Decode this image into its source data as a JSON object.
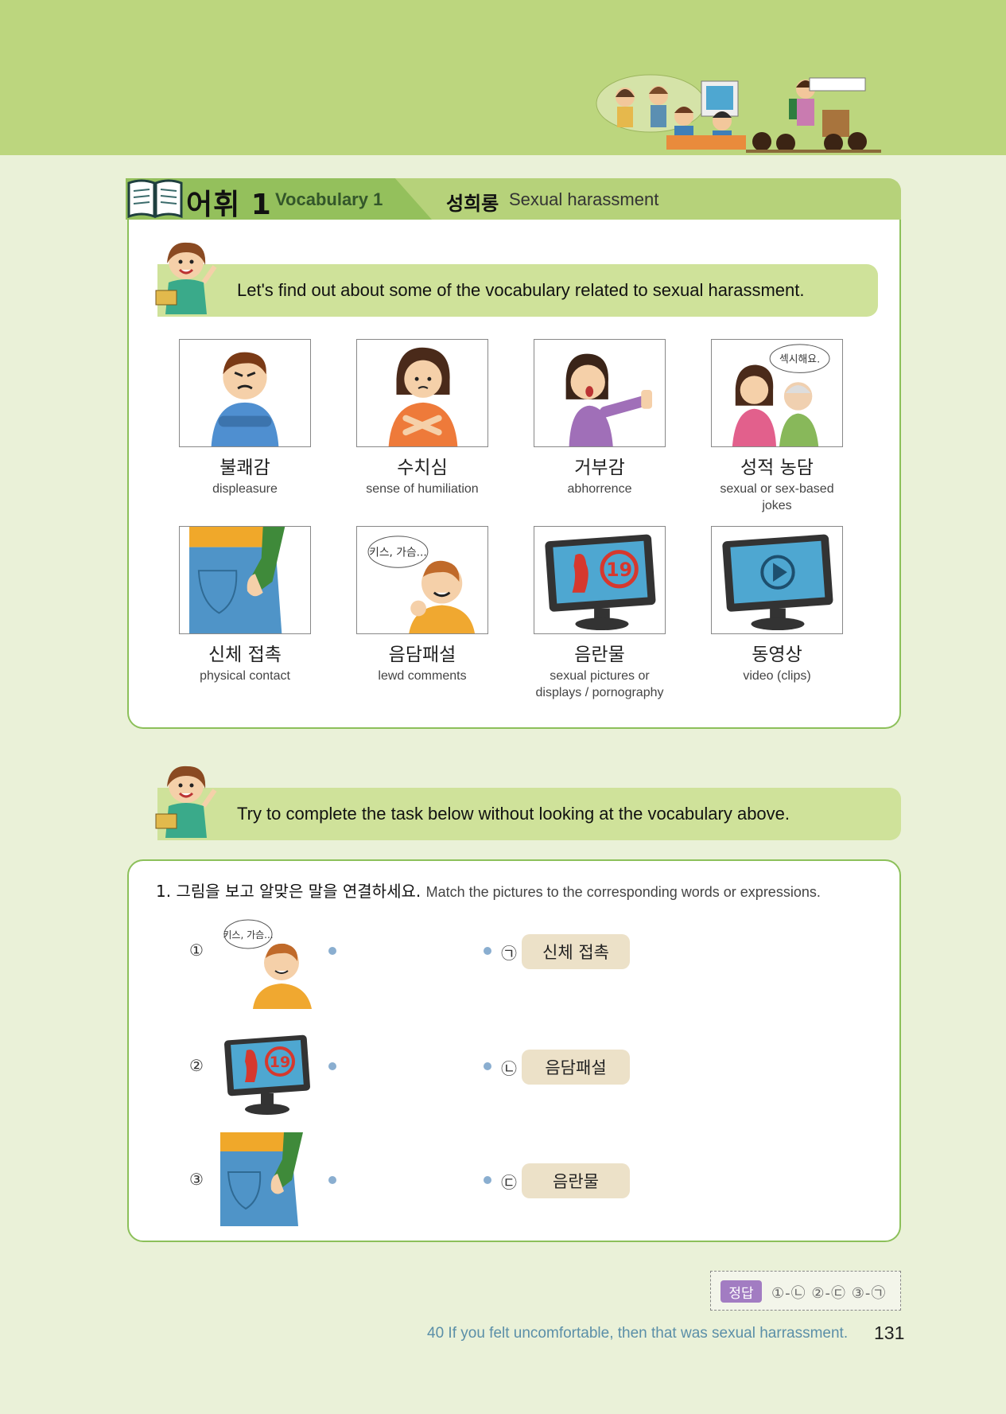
{
  "header": {
    "section_ko": "어휘 1",
    "section_en": "Vocabulary 1",
    "topic_ko": "성희롱",
    "topic_en": "Sexual harassment"
  },
  "intro": {
    "text1": "Let's find out about some of the vocabulary related to sexual harassment.",
    "text2": "Try to complete the task below without looking at the vocabulary above."
  },
  "vocabulary": [
    {
      "ko": "불쾌감",
      "en": "displeasure"
    },
    {
      "ko": "수치심",
      "en": "sense of humiliation"
    },
    {
      "ko": "거부감",
      "en": "abhorrence"
    },
    {
      "ko": "성적 농담",
      "en": "sexual or sex-based jokes"
    },
    {
      "ko": "신체 접촉",
      "en": "physical contact"
    },
    {
      "ko": "음담패설",
      "en": "lewd comments"
    },
    {
      "ko": "음란물",
      "en": "sexual pictures or displays / pornography"
    },
    {
      "ko": "동영상",
      "en": "video (clips)"
    }
  ],
  "picture_text": {
    "speech_joke": "섹시해요.",
    "speech_lewd": "키스, 가슴...",
    "sign_19": "19"
  },
  "exercise": {
    "question_ko": "1. 그림을 보고 알맞은 말을 연결하세요.",
    "question_en": "Match the pictures to the corresponding words or expressions.",
    "left": [
      "①",
      "②",
      "③"
    ],
    "right": [
      {
        "mark": "㉠",
        "word": "신체 접촉"
      },
      {
        "mark": "㉡",
        "word": "음담패설"
      },
      {
        "mark": "㉢",
        "word": "음란물"
      }
    ]
  },
  "answer": {
    "label": "정답",
    "text": "①-㉡  ②-㉢  ③-㉠"
  },
  "footer": {
    "text": "40 If you felt uncomfortable, then that was sexual harrassment.",
    "page": "131"
  }
}
